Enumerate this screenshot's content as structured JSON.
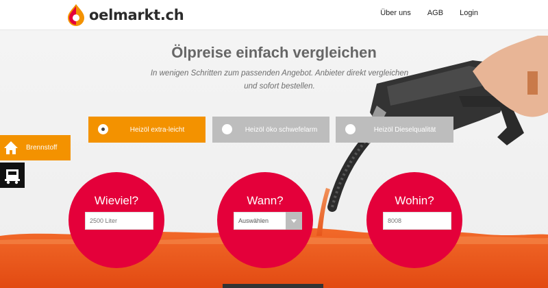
{
  "header": {
    "logo_text": "oelmarkt.ch",
    "nav": [
      "Über uns",
      "AGB",
      "Login"
    ]
  },
  "hero": {
    "title": "Ölpreise einfach vergleichen",
    "subtitle": "In wenigen Schritten zum passenden Angebot. Anbieter direkt vergleichen und sofort bestellen."
  },
  "tabs": [
    {
      "label": "Heizöl extra-leicht",
      "selected": true
    },
    {
      "label": "Heizöl öko schwefelarm",
      "selected": false
    },
    {
      "label": "Heizöl Dieselqualität",
      "selected": false
    }
  ],
  "sidebar": {
    "item1_label": "Brennstoff",
    "item1_icon": "house-icon",
    "item2_icon": "truck-icon"
  },
  "form": {
    "quantity": {
      "title": "Wieviel?",
      "placeholder": "2500 Liter"
    },
    "date": {
      "title": "Wann?",
      "selected": "Auswählen"
    },
    "location": {
      "title": "Wohin?",
      "placeholder": "8008"
    }
  },
  "colors": {
    "accent_orange": "#f39200",
    "accent_red": "#e4003a",
    "tab_inactive": "#bdbdbd"
  }
}
